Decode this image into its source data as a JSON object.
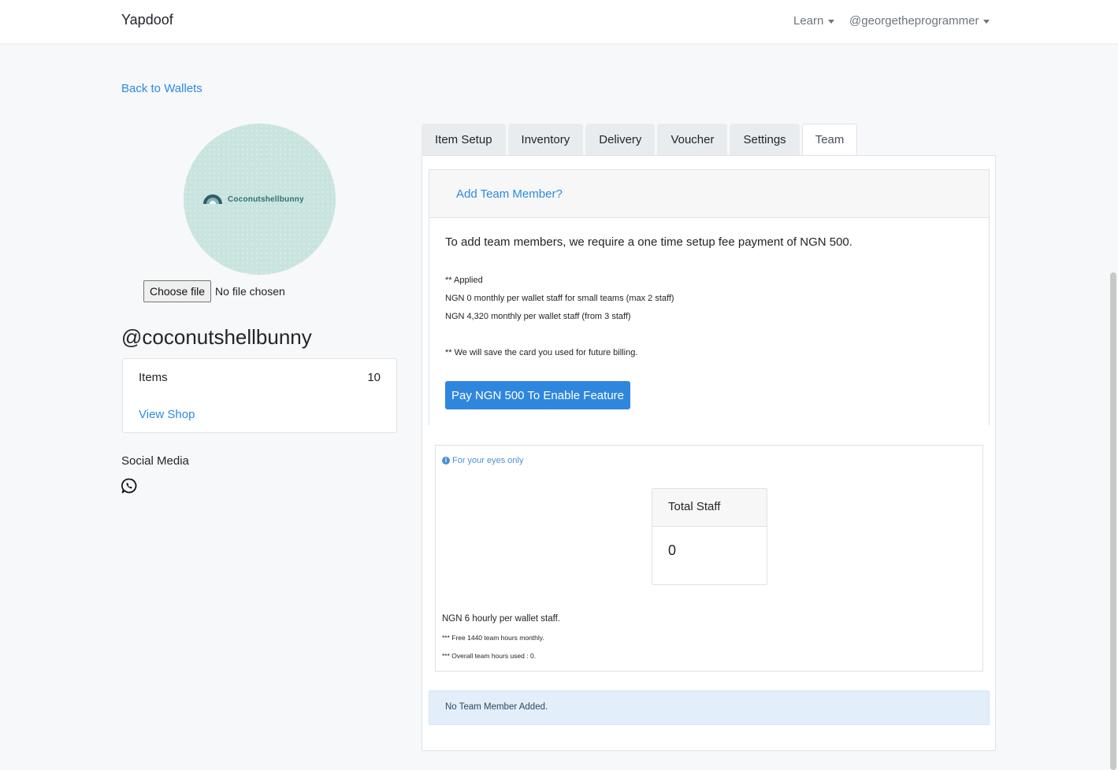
{
  "navbar": {
    "brand": "Yapdoof",
    "learn": "Learn",
    "user": "@georgetheprogrammer"
  },
  "back_link": "Back to Wallets",
  "avatar": {
    "logo_text": "Coconutshellbunny"
  },
  "file_input": {
    "button": "Choose file",
    "status": "No file chosen"
  },
  "shop": {
    "name": "@coconutshellbunny",
    "items_label": "Items",
    "items_count": "10",
    "view_shop": "View Shop"
  },
  "social": {
    "title": "Social Media"
  },
  "tabs": [
    "Item Setup",
    "Inventory",
    "Delivery",
    "Voucher",
    "Settings",
    "Team"
  ],
  "team": {
    "add_link": "Add Team Member?",
    "fee_text": "To add team members, we require a one time setup fee payment of NGN 500.",
    "applied": "** Applied",
    "line_small_teams": "NGN 0 monthly per wallet staff for small teams (max 2 staff)",
    "line_large_teams": "NGN 4,320 monthly per wallet staff (from 3 staff)",
    "card_note": "** We will save the card you used for future billing.",
    "pay_button": "Pay NGN 500 To Enable Feature"
  },
  "private": {
    "note": "For your eyes only",
    "total_staff_label": "Total Staff",
    "total_staff_value": "0",
    "hourly": "NGN 6 hourly per wallet staff.",
    "free_hours": "*** Free 1440 team hours monthly.",
    "used_hours": "*** Overall team hours used : 0."
  },
  "alert": "No Team Member Added.",
  "colors": {
    "primary": "#2f86dd",
    "link": "#2d8ae0",
    "alert_bg": "#e2eefa"
  }
}
